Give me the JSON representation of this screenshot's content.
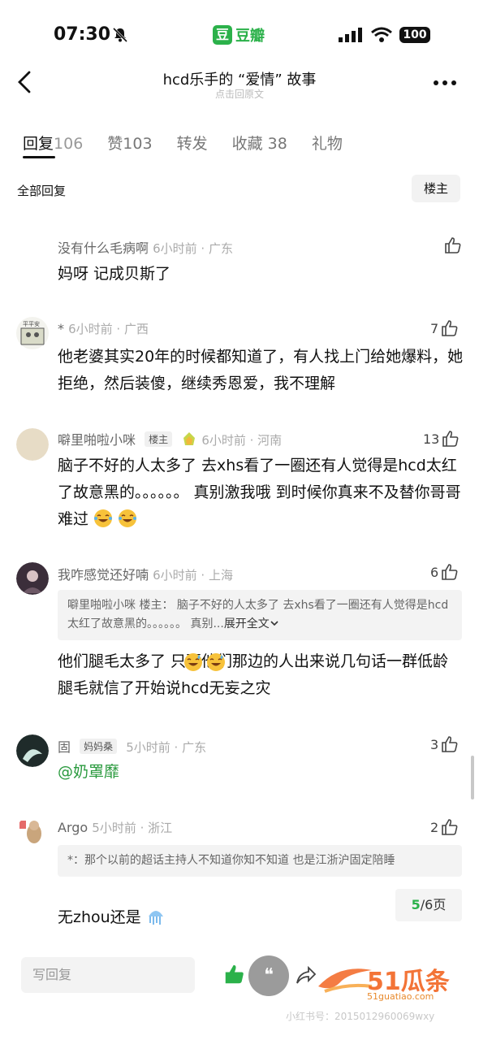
{
  "status": {
    "time": "07:30",
    "battery": "100",
    "app_icon_char": "豆",
    "app_name": "豆瓣"
  },
  "nav": {
    "title": "hcd乐手的 “爱情” 故事",
    "subtitle": "点击回原文"
  },
  "tabs": [
    {
      "label": "回复",
      "count": "106",
      "active": true
    },
    {
      "label": "赞",
      "count": "103"
    },
    {
      "label": "转发",
      "count": ""
    },
    {
      "label": "收藏",
      "count": "38"
    },
    {
      "label": "礼物",
      "count": ""
    }
  ],
  "filter": {
    "all_label": "全部回复",
    "op_button": "楼主"
  },
  "comments": [
    {
      "name": "没有什么毛病啊",
      "meta": "6小时前 · 广东",
      "likes": "",
      "text": "妈呀 记成贝斯了"
    },
    {
      "name": "*",
      "meta": "6小时前 · 广西",
      "likes": "7",
      "text": "他老婆其实20年的时候都知道了，有人找上门给她爆料，她拒绝，然后装傻，继续秀恩爱，我不理解"
    },
    {
      "name": "噼里啪啦小咪",
      "tag": "楼主",
      "meta": "6小时前 · 河南",
      "likes": "13",
      "text": "脑子不好的人太多了 去xhs看了一圈还有人觉得是hcd太红了故意黑的。。。。。。 真别激我哦 到时候你真来不及替你哥哥难过"
    },
    {
      "name": "我咋感觉还好喃",
      "meta": "6小时前 · 上海",
      "likes": "6",
      "quote": "噼里啪啦小咪 楼主： 脑子不好的人太多了 去xhs看了一圈还有人觉得是hcd太红了故意黑的。。。。。。 真别...",
      "expand": "展开全文",
      "text": "他们腿毛太多了 只要他们那边的人出来说几句话一群低龄腿毛就信了开始说hcd无妄之灾"
    },
    {
      "name": "固",
      "tag": "妈妈桑",
      "meta": "5小时前 · 广东",
      "likes": "3",
      "mention": "@奶罩靡"
    },
    {
      "name": "Argo",
      "meta": "5小时前 · 浙江",
      "likes": "2",
      "quote": "*：那个以前的超话主持人不知道你知不知道 也是江浙沪固定陪睡",
      "text": "无zhou还是"
    }
  ],
  "pager": {
    "current": "5",
    "total": "/6页"
  },
  "bottom": {
    "reply_placeholder": "写回复",
    "quote_glyph": "❝"
  },
  "watermark": {
    "logo": "51瓜条",
    "url": "51guatiao.com",
    "sub": "小红书号：2015012960069wxy"
  },
  "colors": {
    "accent": "#2bb14a"
  }
}
